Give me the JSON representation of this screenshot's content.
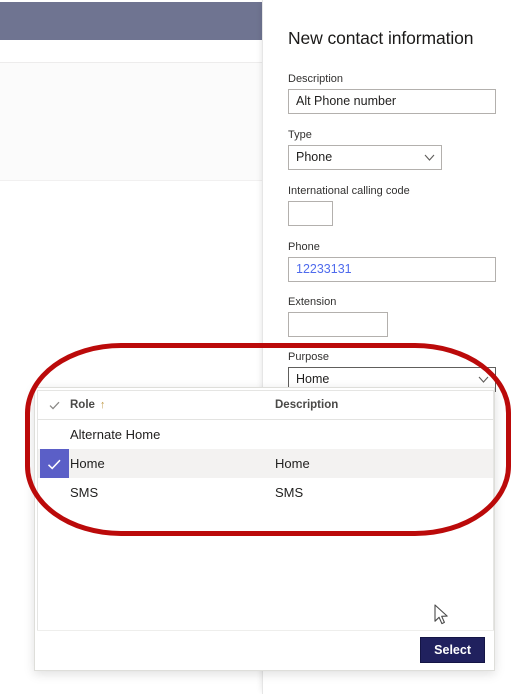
{
  "background_app": {
    "topbar_color": "#6f7491"
  },
  "panel": {
    "title": "New contact information",
    "fields": {
      "description": {
        "label": "Description",
        "value": "Alt Phone number",
        "placeholder": ""
      },
      "type": {
        "label": "Type",
        "value": "Phone",
        "options": [
          "Phone"
        ]
      },
      "international_calling_code": {
        "label": "International calling code",
        "value": "",
        "placeholder": ""
      },
      "phone": {
        "label": "Phone",
        "value": "12233131",
        "placeholder": "",
        "value_color": "#4f6bed"
      },
      "extension": {
        "label": "Extension",
        "value": "",
        "placeholder": ""
      },
      "purpose": {
        "label": "Purpose",
        "value": "Home",
        "options": [
          "Alternate Home",
          "Home",
          "SMS"
        ]
      }
    }
  },
  "lookup_dialog": {
    "table": {
      "columns": [
        "",
        "Role",
        "Description"
      ],
      "sort_column": "Role",
      "sort_direction": "ascending",
      "sort_glyph": "↑",
      "rows": [
        {
          "selected": false,
          "role": "Alternate Home",
          "description": ""
        },
        {
          "selected": true,
          "role": "Home",
          "description": "Home"
        },
        {
          "selected": false,
          "role": "SMS",
          "description": "SMS"
        }
      ]
    },
    "footer": {
      "select_label": "Select"
    }
  },
  "annotation": {
    "highlight_color": "#bb0a0a",
    "shape": "rounded-rectangle"
  },
  "colors": {
    "accent_checkbox": "#5b5fc7",
    "primary_button": "#20215e",
    "sort_arrow": "#c19c4c"
  }
}
